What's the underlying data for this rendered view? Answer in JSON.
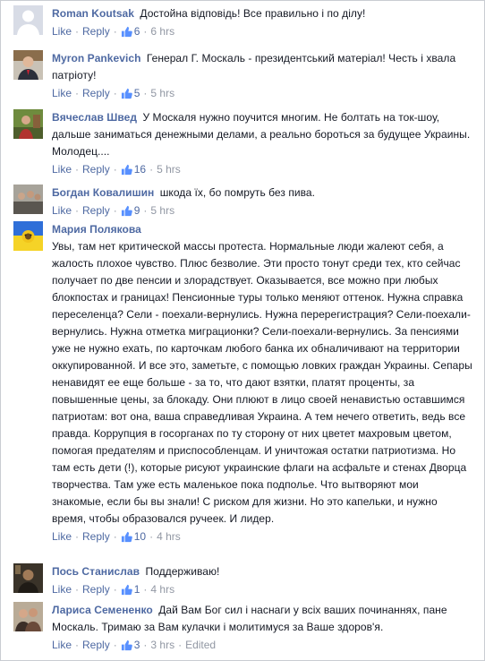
{
  "labels": {
    "like": "Like",
    "reply": "Reply",
    "separator": "·"
  },
  "colors": {
    "author": "#3b5998",
    "link": "#4e69a2",
    "meta": "#9197a3",
    "text": "#141823"
  },
  "comments": [
    {
      "author": "Roman Koutsak",
      "text": "Достойна відповідь! Все правильно і по ділу!",
      "likes": "6",
      "time": "6 hrs",
      "avatar_icon": "default-avatar-icon"
    },
    {
      "author": "Myron Pankevich",
      "text": "Генерал Г. Москаль - президентський матеріал! Честь і хвала патріоту!",
      "likes": "5",
      "time": "5 hrs",
      "avatar_icon": "man-in-suit-avatar-icon"
    },
    {
      "author": "Вячеслав Швед",
      "text": "У Москаля нужно поучится многим. Не болтать на ток-шоу, дальше заниматься денежными делами, а реально бороться за будущее Украины. Молодец....",
      "likes": "16",
      "time": "5 hrs",
      "avatar_icon": "outdoor-photo-avatar-icon"
    },
    {
      "author": "Богдан Ковалишин",
      "text": "шкода їх, бо помруть без пива.",
      "likes": "9",
      "time": "5 hrs",
      "avatar_icon": "crowd-photo-avatar-icon"
    },
    {
      "author": "Мария Полякова",
      "text": "Увы, там нет критической массы протеста. Нормальные люди жалеют себя, а жалость плохое чувство. Плюс безволие. Эти просто тонут среди тех, кто сейчас получает по две пенсии и злорадствует. Оказывается, все можно при любых блокпостах и границах! Пенсионные туры только меняют оттенок. Нужна справка переселенца? Сели - поехали-вернулись. Нужна перерегистрация? Сели-поехали-вернулись. Нужна отметка миграционки? Сели-поехали-вернулись. За пенсиями уже не нужно ехать, по карточкам любого банка их обналичивают на территории оккупированной. И все это, заметьте, с помощью ловких граждан Украины. Сепары ненавидят ее еще больше - за то, что дают взятки, платят проценты, за повышенные цены, за блокаду. Они плюют в лицо своей ненавистью оставшимся патриотам: вот она, ваша справедливая Украина. А тем нечего ответить, ведь все правда. Коррупция в госорганах по ту сторону от них цветет махровым цветом, помогая предателям и приспособленцам. И уничтожая остатки патриотизма. Но там есть дети (!), которые рисуют украинские флаги на асфальте и стенах Дворца творчества. Там уже есть маленькое пока подполье. Что вытворяют мои знакомые, если бы вы знали! С риском для жизни. Но это капельки, и нужно время, чтобы образовался ручеек. И лидер.",
      "likes": "10",
      "time": "4 hrs",
      "avatar_icon": "flag-sunflower-avatar-icon"
    },
    {
      "author": "Пось Станислав",
      "text": "Поддерживаю!",
      "likes": "1",
      "time": "4 hrs",
      "avatar_icon": "dark-portrait-avatar-icon"
    },
    {
      "author": "Лариса Семененко",
      "text": "Дай Вам Бог сил і наснаги у всіх ваших починаннях, пане Москаль. Тримаю за Вам кулачки і молитимуся за Ваше здоров'я.",
      "likes": "3",
      "time": "3 hrs",
      "edited": "Edited",
      "avatar_icon": "couple-photo-avatar-icon"
    }
  ]
}
